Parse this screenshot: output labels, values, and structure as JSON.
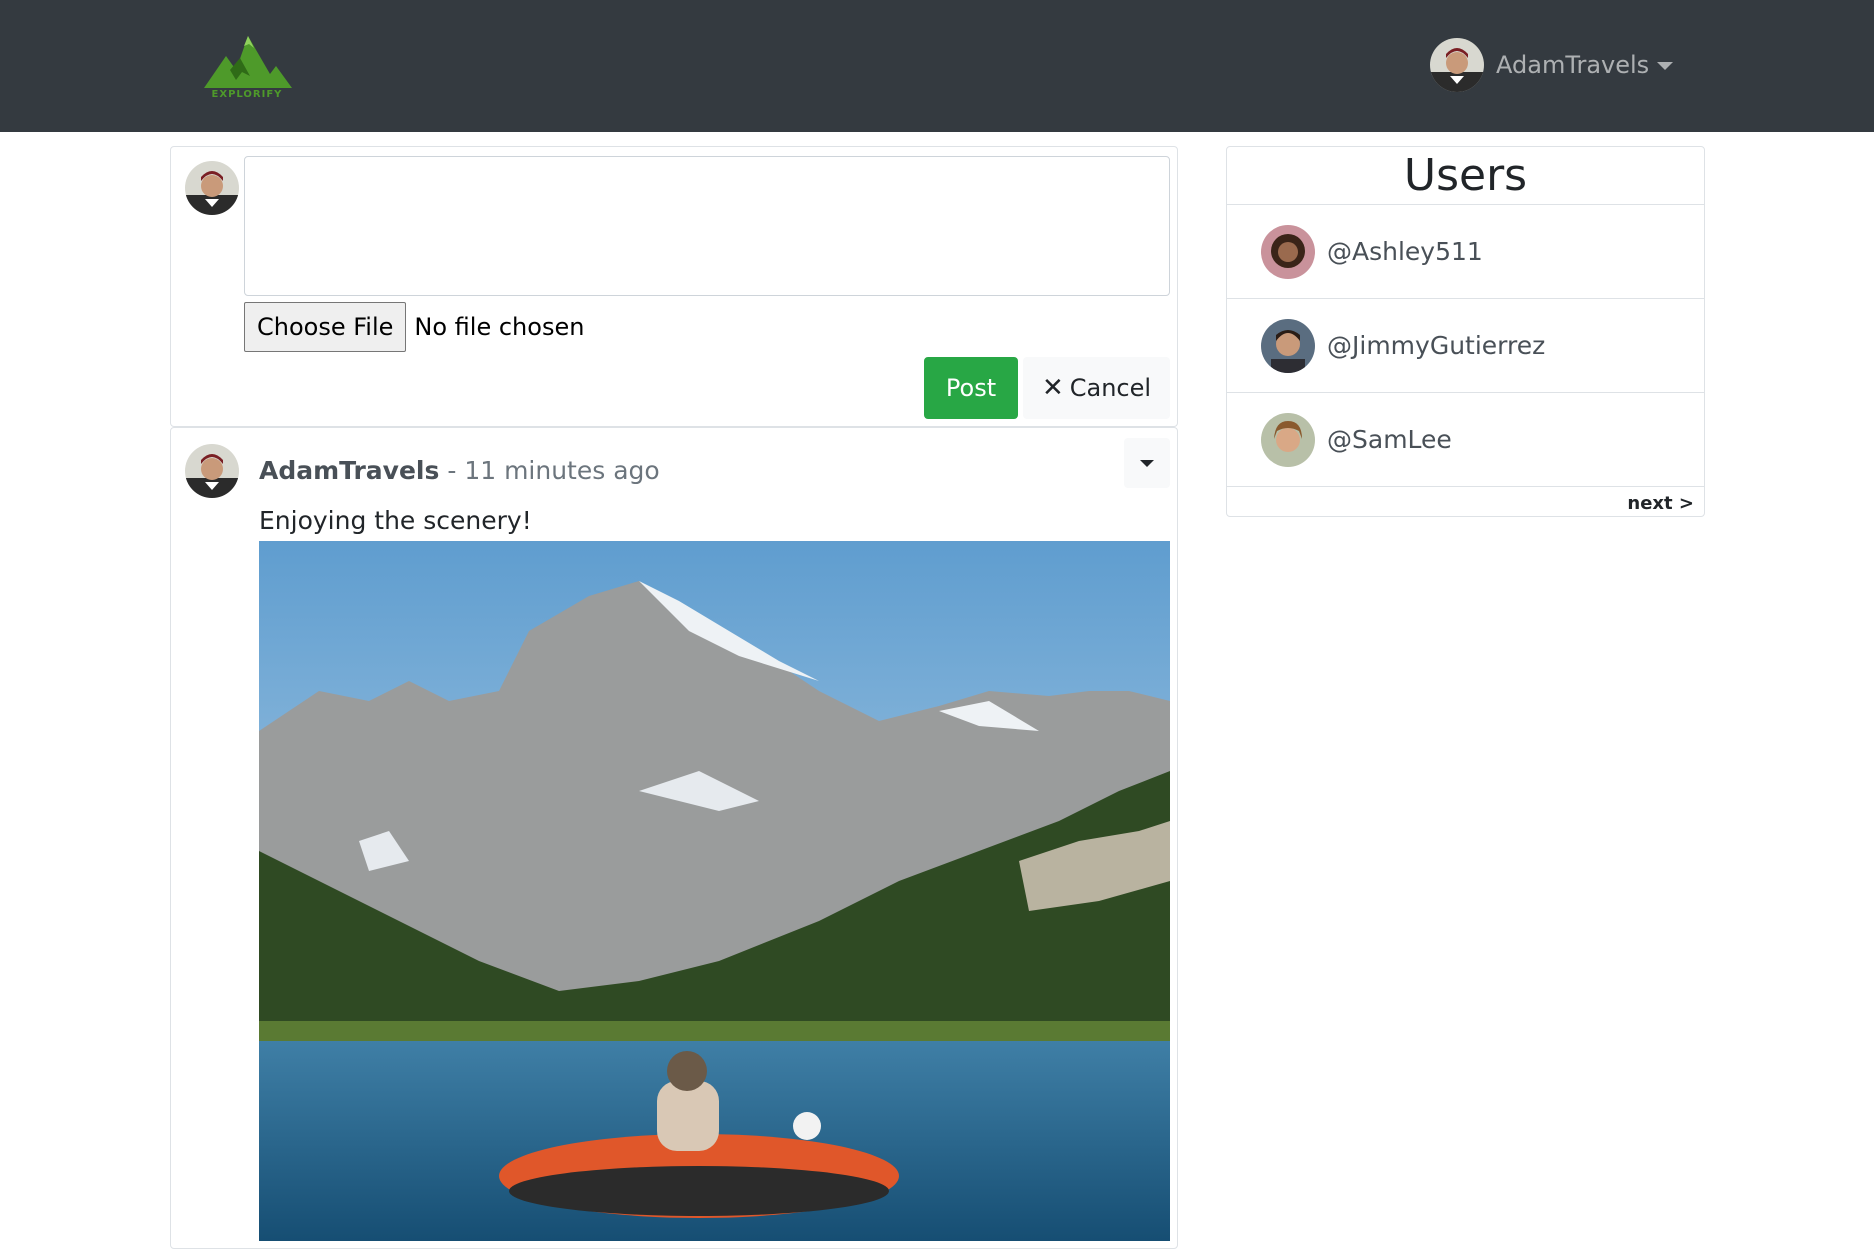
{
  "navbar": {
    "logo_text": "EXPLORIFY",
    "logo_icon": "mountain-icon",
    "username": "AdamTravels"
  },
  "composer": {
    "textarea_value": "",
    "choose_file_label": "Choose File",
    "no_file_text": "No file chosen",
    "post_label": "Post",
    "cancel_label": "Cancel",
    "cancel_icon": "close-icon"
  },
  "post": {
    "author": "AdamTravels",
    "separator": "-",
    "time": "11 minutes ago",
    "caption": "Enjoying the scenery!",
    "image_subject": "mountain lake with kayaker"
  },
  "users_panel": {
    "title": "Users",
    "users": [
      {
        "handle": "@Ashley511"
      },
      {
        "handle": "@JimmyGutierrez"
      },
      {
        "handle": "@SamLee"
      }
    ],
    "next_label": "next >"
  },
  "colors": {
    "navbar_bg": "#343a40",
    "post_button": "#28a745",
    "logo_green": "#4e9a2a"
  }
}
